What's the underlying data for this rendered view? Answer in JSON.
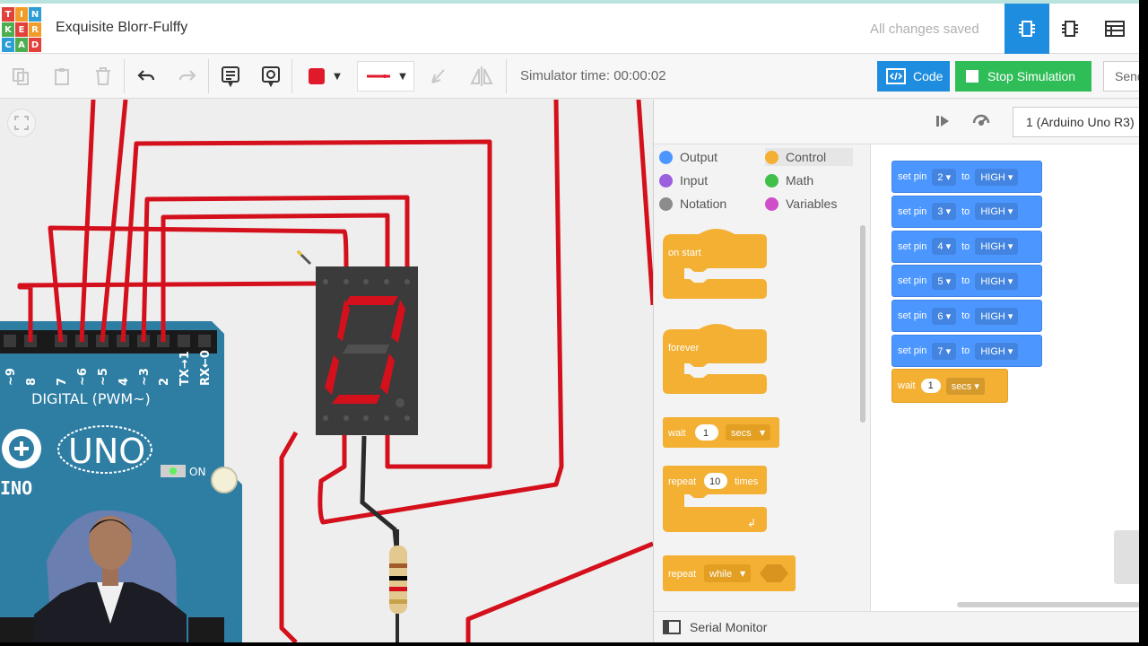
{
  "app": {
    "logo_letters": [
      "TIN",
      "KER",
      "CAD"
    ],
    "logo_colors": [
      "#e2403b",
      "#f29c29",
      "#2b9ed8",
      "#4cae4f",
      "#e2403b",
      "#f29c29",
      "#2b9ed8",
      "#4cae4f",
      "#e2403b"
    ],
    "project_title": "Exquisite Blorr-Fulffy",
    "save_status": "All changes saved",
    "header_buttons": [
      "circuit-view-icon",
      "component-list-icon",
      "schematic-table-icon"
    ]
  },
  "toolbar": {
    "tools": [
      "copy-icon",
      "paste-icon",
      "delete-icon",
      "undo-icon",
      "redo-icon",
      "notes-icon",
      "note-visibility-icon",
      "wire-color",
      "wire-type",
      "rotate-icon",
      "flip-icon"
    ],
    "wire_color": "#e0192b",
    "sim_time_label": "Simulator time: 00:00:02",
    "code_label": "Code",
    "stop_label": "Stop Simulation",
    "send_label": "Send To"
  },
  "canvas": {
    "wire_color": "#d4101c",
    "board": {
      "pin_labels": [
        "~9",
        "8",
        "7",
        "~6",
        "~5",
        "4",
        "~3",
        "2",
        "TX→1",
        "RX←0"
      ],
      "digital_label": "DIGITAL (PWM~)",
      "brand_text": "UNO",
      "left_text": "INO",
      "on_label": "ON",
      "board_color": "#2e7ea4"
    },
    "display": {
      "digit": "0",
      "segment_color": "#d4101c"
    }
  },
  "code_panel": {
    "device": "1 (Arduino Uno R3)",
    "categories": [
      {
        "label": "Output",
        "color": "#4c97ff"
      },
      {
        "label": "Control",
        "color": "#f3b033"
      },
      {
        "label": "Input",
        "color": "#9b5fe0"
      },
      {
        "label": "Math",
        "color": "#40bf4a"
      },
      {
        "label": "Notation",
        "color": "#8c8c8c"
      },
      {
        "label": "Variables",
        "color": "#cf4fc9"
      }
    ],
    "palette_blocks": {
      "on_start": "on start",
      "forever": "forever",
      "wait": {
        "label": "wait",
        "value": "1",
        "unit": "secs"
      },
      "repeat": {
        "label": "repeat",
        "value": "10",
        "unit": "times"
      },
      "repeat_while": {
        "label": "repeat",
        "mode": "while"
      }
    },
    "script": [
      {
        "label": "set pin",
        "pin": "2",
        "to": "to",
        "state": "HIGH"
      },
      {
        "label": "set pin",
        "pin": "3",
        "to": "to",
        "state": "HIGH"
      },
      {
        "label": "set pin",
        "pin": "4",
        "to": "to",
        "state": "HIGH"
      },
      {
        "label": "set pin",
        "pin": "5",
        "to": "to",
        "state": "HIGH"
      },
      {
        "label": "set pin",
        "pin": "6",
        "to": "to",
        "state": "HIGH"
      },
      {
        "label": "set pin",
        "pin": "7",
        "to": "to",
        "state": "HIGH"
      }
    ],
    "script_wait": {
      "label": "wait",
      "value": "1",
      "unit": "secs"
    },
    "serial_monitor": "Serial Monitor"
  }
}
